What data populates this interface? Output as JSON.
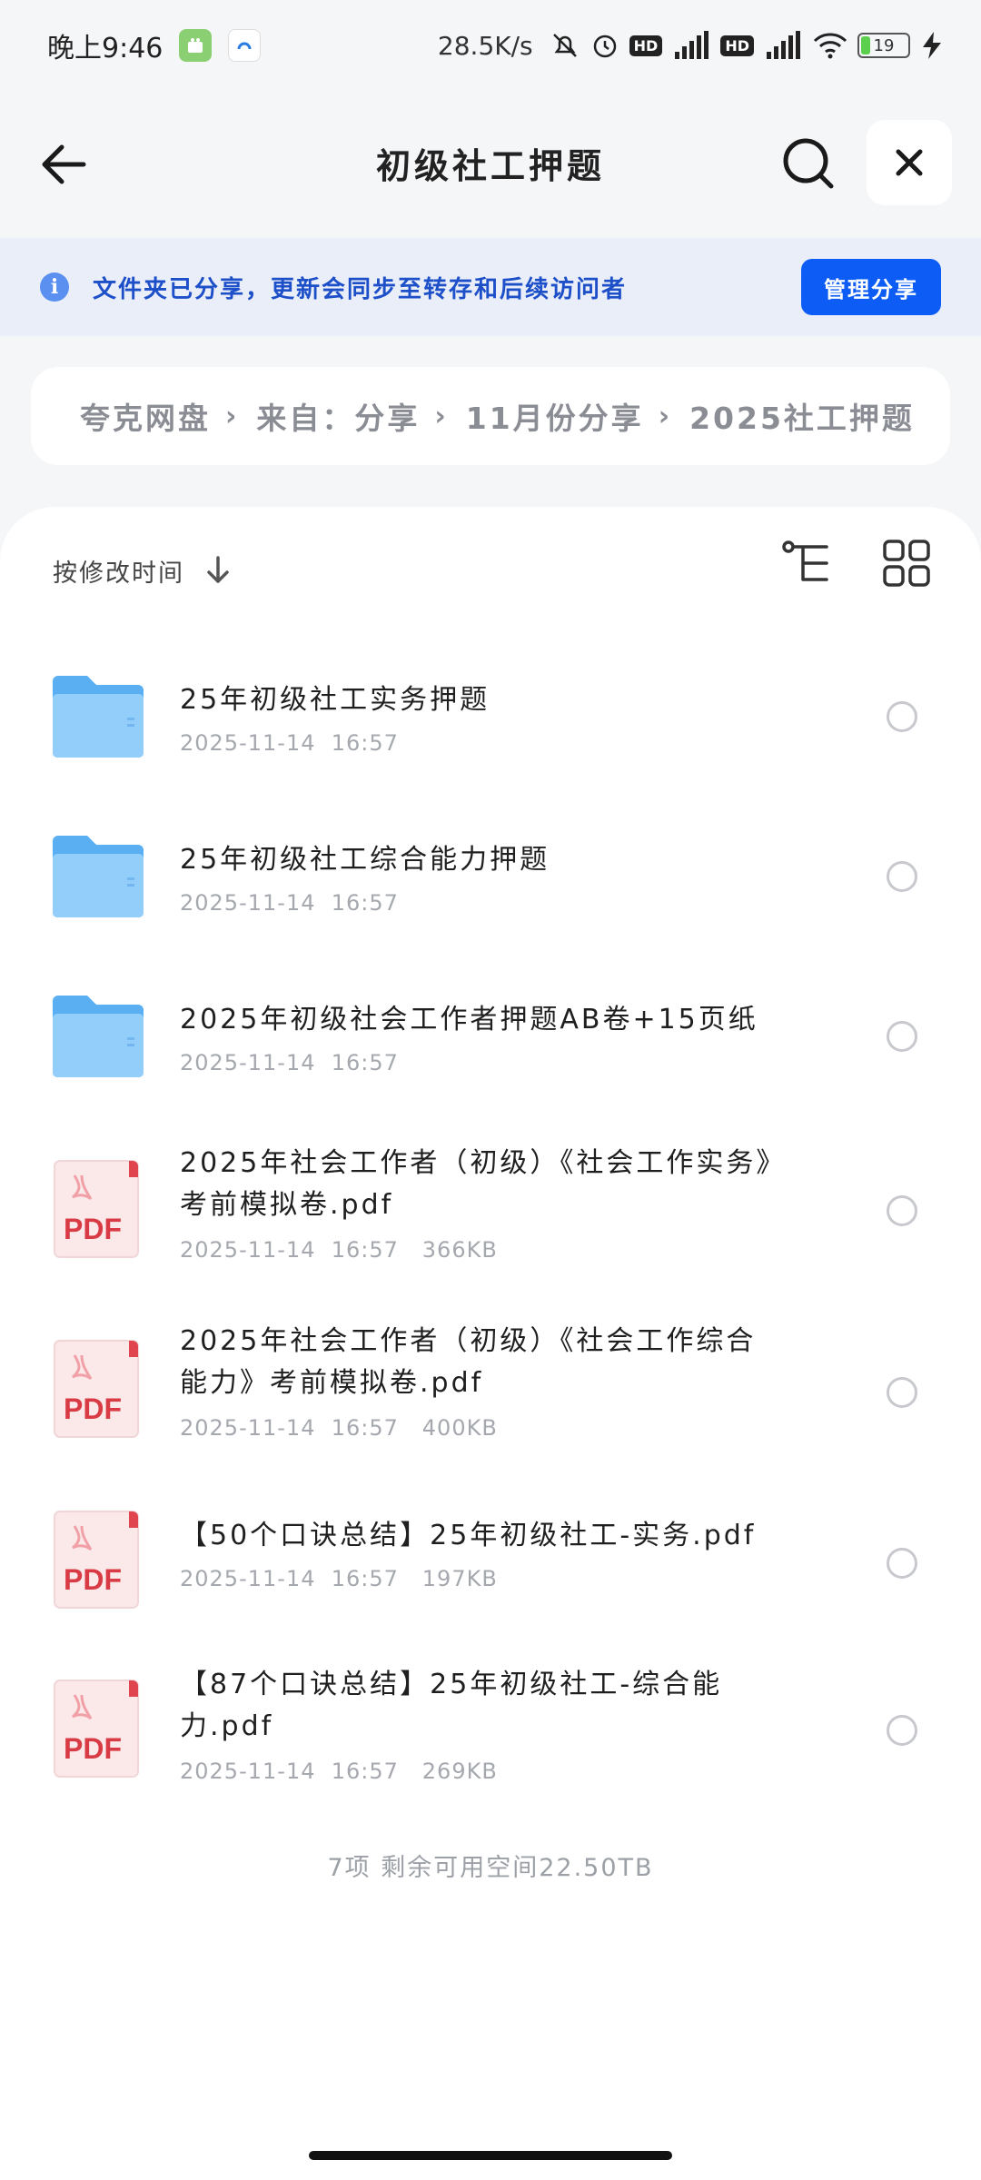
{
  "status_bar": {
    "time": "晚上9:46",
    "net_speed": "28.5K/s",
    "battery_level": "19",
    "hd1": "HD",
    "hd2": "HD"
  },
  "header": {
    "title": "初级社工押题"
  },
  "banner": {
    "text": "文件夹已分享，更新会同步至转存和后续访问者",
    "button_label": "管理分享"
  },
  "breadcrumb": {
    "items": [
      "夸克网盘",
      "来自：分享",
      "11月份分享",
      "2025社工押题"
    ]
  },
  "sort": {
    "label": "按修改时间"
  },
  "files": [
    {
      "type": "folder",
      "name": "25年初级社工实务押题",
      "meta": "2025-11-14  16:57"
    },
    {
      "type": "folder",
      "name": "25年初级社工综合能力押题",
      "meta": "2025-11-14  16:57"
    },
    {
      "type": "folder",
      "name": "2025年初级社会工作者押题AB卷+15页纸",
      "meta": "2025-11-14  16:57"
    },
    {
      "type": "pdf",
      "name": "2025年社会工作者（初级）《社会工作实务》考前模拟卷.pdf",
      "meta": "2025-11-14  16:57   366KB"
    },
    {
      "type": "pdf",
      "name": "2025年社会工作者（初级）《社会工作综合能力》考前模拟卷.pdf",
      "meta": "2025-11-14  16:57   400KB"
    },
    {
      "type": "pdf",
      "name": "【50个口诀总结】25年初级社工-实务.pdf",
      "meta": "2025-11-14  16:57   197KB"
    },
    {
      "type": "pdf",
      "name": "【87个口诀总结】25年初级社工-综合能力.pdf",
      "meta": "2025-11-14  16:57   269KB"
    }
  ],
  "pdf_label": "PDF",
  "footer": {
    "summary": "7项  剩余可用空间22.50TB"
  }
}
